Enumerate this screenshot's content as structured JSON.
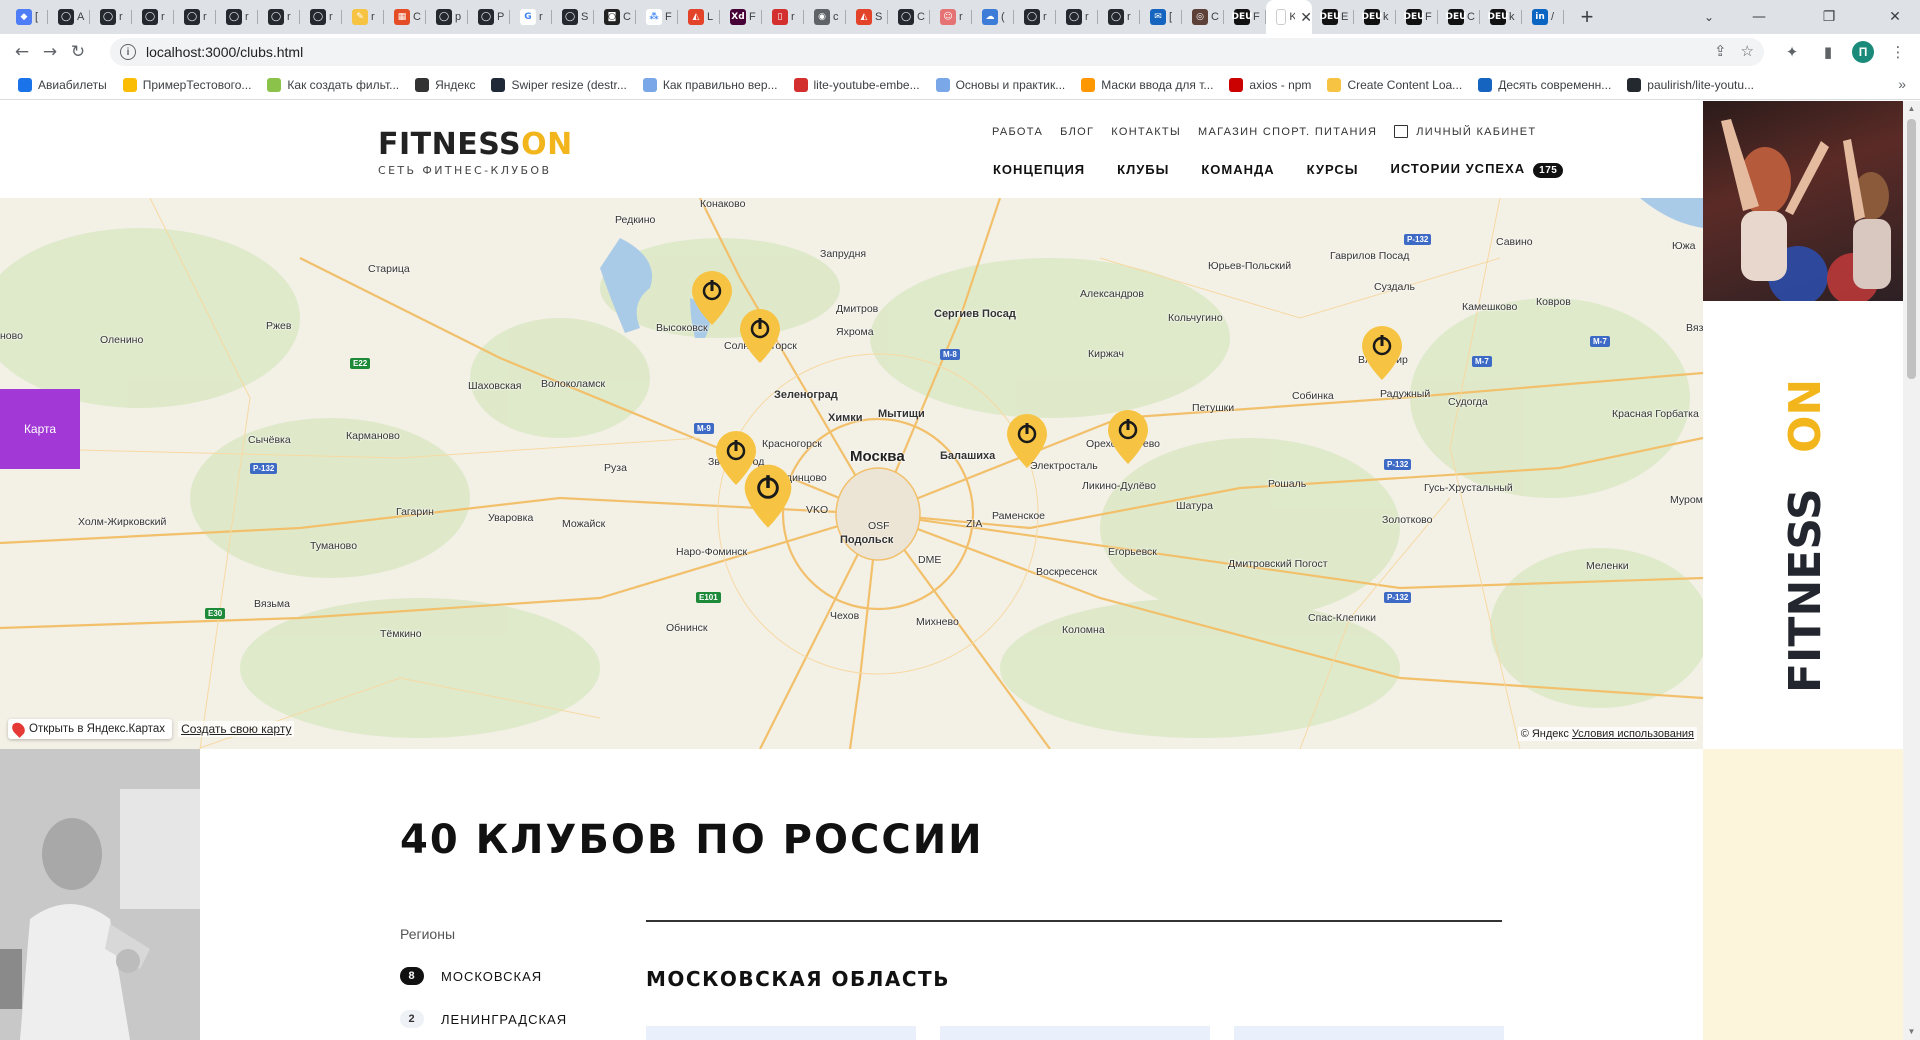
{
  "browser": {
    "tabs": [
      {
        "fav": "#4f7cf7",
        "glyph": "◆",
        "label": "["
      },
      {
        "fav": "#24292f",
        "glyph": "◯",
        "label": "A"
      },
      {
        "fav": "#24292f",
        "glyph": "◯",
        "label": "r"
      },
      {
        "fav": "#24292f",
        "glyph": "◯",
        "label": "r"
      },
      {
        "fav": "#24292f",
        "glyph": "◯",
        "label": "r"
      },
      {
        "fav": "#24292f",
        "glyph": "◯",
        "label": "r"
      },
      {
        "fav": "#24292f",
        "glyph": "◯",
        "label": "r"
      },
      {
        "fav": "#24292f",
        "glyph": "◯",
        "label": "r"
      },
      {
        "fav": "#f6c343",
        "glyph": "✎",
        "label": "r"
      },
      {
        "fav": "#e44d26",
        "glyph": "▦",
        "label": "C"
      },
      {
        "fav": "#24292f",
        "glyph": "◯",
        "label": "p"
      },
      {
        "fav": "#24292f",
        "glyph": "◯",
        "label": "P"
      },
      {
        "fav": "#ffffff",
        "glyph": "G",
        "label": "r"
      },
      {
        "fav": "#24292f",
        "glyph": "◯",
        "label": "S"
      },
      {
        "fav": "#222222",
        "glyph": "◙",
        "label": "C"
      },
      {
        "fav": "#ffffff",
        "glyph": "⁂",
        "label": "F"
      },
      {
        "fav": "#e24329",
        "glyph": "◭",
        "label": "L"
      },
      {
        "fav": "#470137",
        "glyph": "Xd",
        "label": "F"
      },
      {
        "fav": "#d32f2f",
        "glyph": "▯",
        "label": "r"
      },
      {
        "fav": "#5f6368",
        "glyph": "◉",
        "label": "c"
      },
      {
        "fav": "#e24329",
        "glyph": "◭",
        "label": "S"
      },
      {
        "fav": "#24292f",
        "glyph": "◯",
        "label": "C"
      },
      {
        "fav": "#e57373",
        "glyph": "☺",
        "label": "r"
      },
      {
        "fav": "#3d7dd8",
        "glyph": "☁",
        "label": "("
      },
      {
        "fav": "#24292f",
        "glyph": "◯",
        "label": "r"
      },
      {
        "fav": "#24292f",
        "glyph": "◯",
        "label": "r"
      },
      {
        "fav": "#24292f",
        "glyph": "◯",
        "label": "r"
      },
      {
        "fav": "#1565c0",
        "glyph": "✉",
        "label": "["
      },
      {
        "fav": "#5d4037",
        "glyph": "◎",
        "label": "C"
      },
      {
        "fav": "#111111",
        "glyph": "DEU",
        "label": "F"
      }
    ],
    "active_tab": {
      "fav": "#ffffff",
      "label": "K"
    },
    "tabs_after": [
      {
        "fav": "#111111",
        "glyph": "DEU",
        "label": "E"
      },
      {
        "fav": "#111111",
        "glyph": "DEU",
        "label": "k"
      },
      {
        "fav": "#111111",
        "glyph": "DEU",
        "label": "F"
      },
      {
        "fav": "#111111",
        "glyph": "DEU",
        "label": "C"
      },
      {
        "fav": "#111111",
        "glyph": "DEU",
        "label": "k"
      },
      {
        "fav": "#0a66c2",
        "glyph": "in",
        "label": "/"
      }
    ],
    "url": "localhost:3000/clubs.html",
    "profile_initial": "П",
    "bookmarks": [
      {
        "label": "Авиабилеты",
        "color": "#1a73e8"
      },
      {
        "label": "ПримерТестового...",
        "color": "#fbbc04"
      },
      {
        "label": "Как создать фильт...",
        "color": "#8bc34a"
      },
      {
        "label": "Яндекс",
        "color": "#333333"
      },
      {
        "label": "Swiper resize (destr...",
        "color": "#1f2937"
      },
      {
        "label": "Как правильно вер...",
        "color": "#7aa7e8"
      },
      {
        "label": "lite-youtube-embe...",
        "color": "#d32f2f"
      },
      {
        "label": "Основы и практик...",
        "color": "#7aa7e8"
      },
      {
        "label": "Маски ввода для т...",
        "color": "#ff9800"
      },
      {
        "label": "axios - npm",
        "color": "#cb0000"
      },
      {
        "label": "Create Content Loa...",
        "color": "#f6c343"
      },
      {
        "label": "Десять современн...",
        "color": "#1565c0"
      },
      {
        "label": "paulirish/lite-youtu...",
        "color": "#24292f"
      }
    ]
  },
  "header": {
    "logo_main": "FITNESS",
    "logo_on": "ON",
    "logo_tagline": "СЕТЬ ФИТНЕС-КЛУБОВ",
    "top_links": [
      "РАБОТА",
      "БЛОГ",
      "КОНТАКТЫ",
      "МАГАЗИН СПОРТ. ПИТАНИЯ"
    ],
    "cabinet": "ЛИЧНЫЙ КАБИНЕТ",
    "main_links": [
      "КОНЦЕПЦИЯ",
      "КЛУБЫ",
      "КОМАНДА",
      "КУРСЫ",
      "ИСТОРИИ УСПЕХА"
    ],
    "success_count": "175"
  },
  "map": {
    "side_tab": "Карта",
    "open_in_yandex": "Открыть в Яндекс.Картах",
    "create_map": "Создать свою карту",
    "copyright": "© Яндекс",
    "terms": "Условия использования",
    "pin_color": "#f6c343"
  },
  "promo": {
    "vertical_word_main": "FITNESS",
    "vertical_word_on": "ON"
  },
  "content": {
    "title": "40 КЛУБОВ ПО РОССИИ",
    "regions_label": "Регионы",
    "regions": [
      {
        "count": "8",
        "name": "МОСКОВСКАЯ",
        "active": true
      },
      {
        "count": "2",
        "name": "ЛЕНИНГРАДСКАЯ",
        "active": false
      }
    ],
    "region_heading": "МОСКОВСКАЯ ОБЛАСТЬ"
  }
}
